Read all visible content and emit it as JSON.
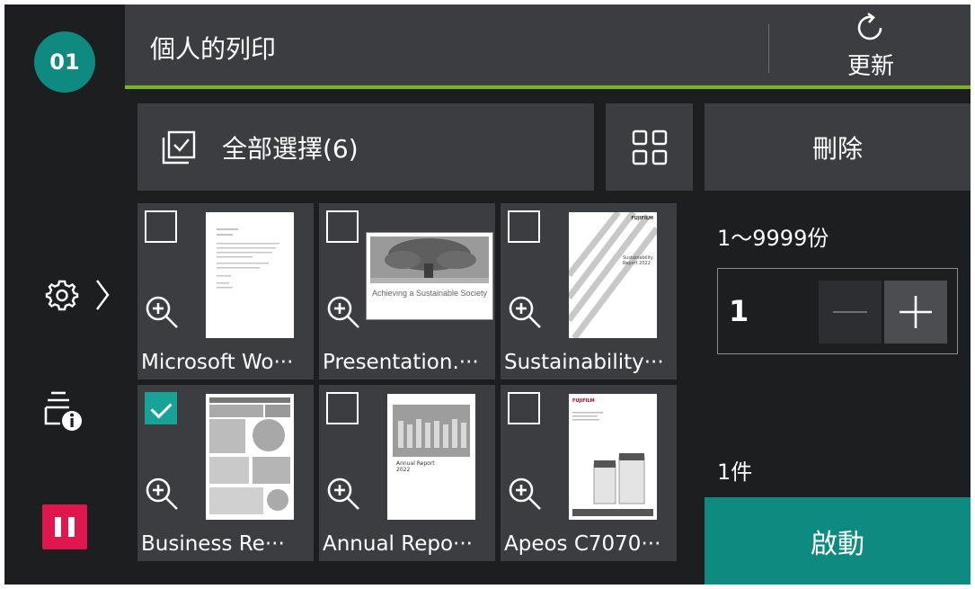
{
  "rail": {
    "job_badge": "01",
    "icons": [
      "gear-icon",
      "chevron-right-icon",
      "job-info-icon",
      "pause-icon"
    ]
  },
  "header": {
    "title": "個人的列印",
    "refresh_label": "更新"
  },
  "toolbar": {
    "select_all_label": "全部選擇(6)",
    "delete_label": "刪除"
  },
  "documents": [
    {
      "name": "Microsoft Wo···",
      "checked": false
    },
    {
      "name": "Presentation.···",
      "checked": false,
      "slide_text": "Achieving a Sustainable Society"
    },
    {
      "name": "Sustainability···",
      "checked": false,
      "cover_text": "Sustainability Report 2022",
      "brand": "FUJIFILM"
    },
    {
      "name": "Business Re···",
      "checked": true
    },
    {
      "name": "Annual Repo···",
      "checked": false,
      "cover_text": "Annual Report 2022"
    },
    {
      "name": "Apeos C7070···",
      "checked": false,
      "brand": "FUJIFILM"
    }
  ],
  "copies": {
    "range_label": "1～9999份",
    "value": "1"
  },
  "summary": {
    "count_label": "1件"
  },
  "start_label": "啟動",
  "colors": {
    "accent_teal": "#0f8a80",
    "header_line": "#7ab51d",
    "pause_red": "#e0174e",
    "panel": "#3b3d41",
    "background": "#1d1e20"
  }
}
